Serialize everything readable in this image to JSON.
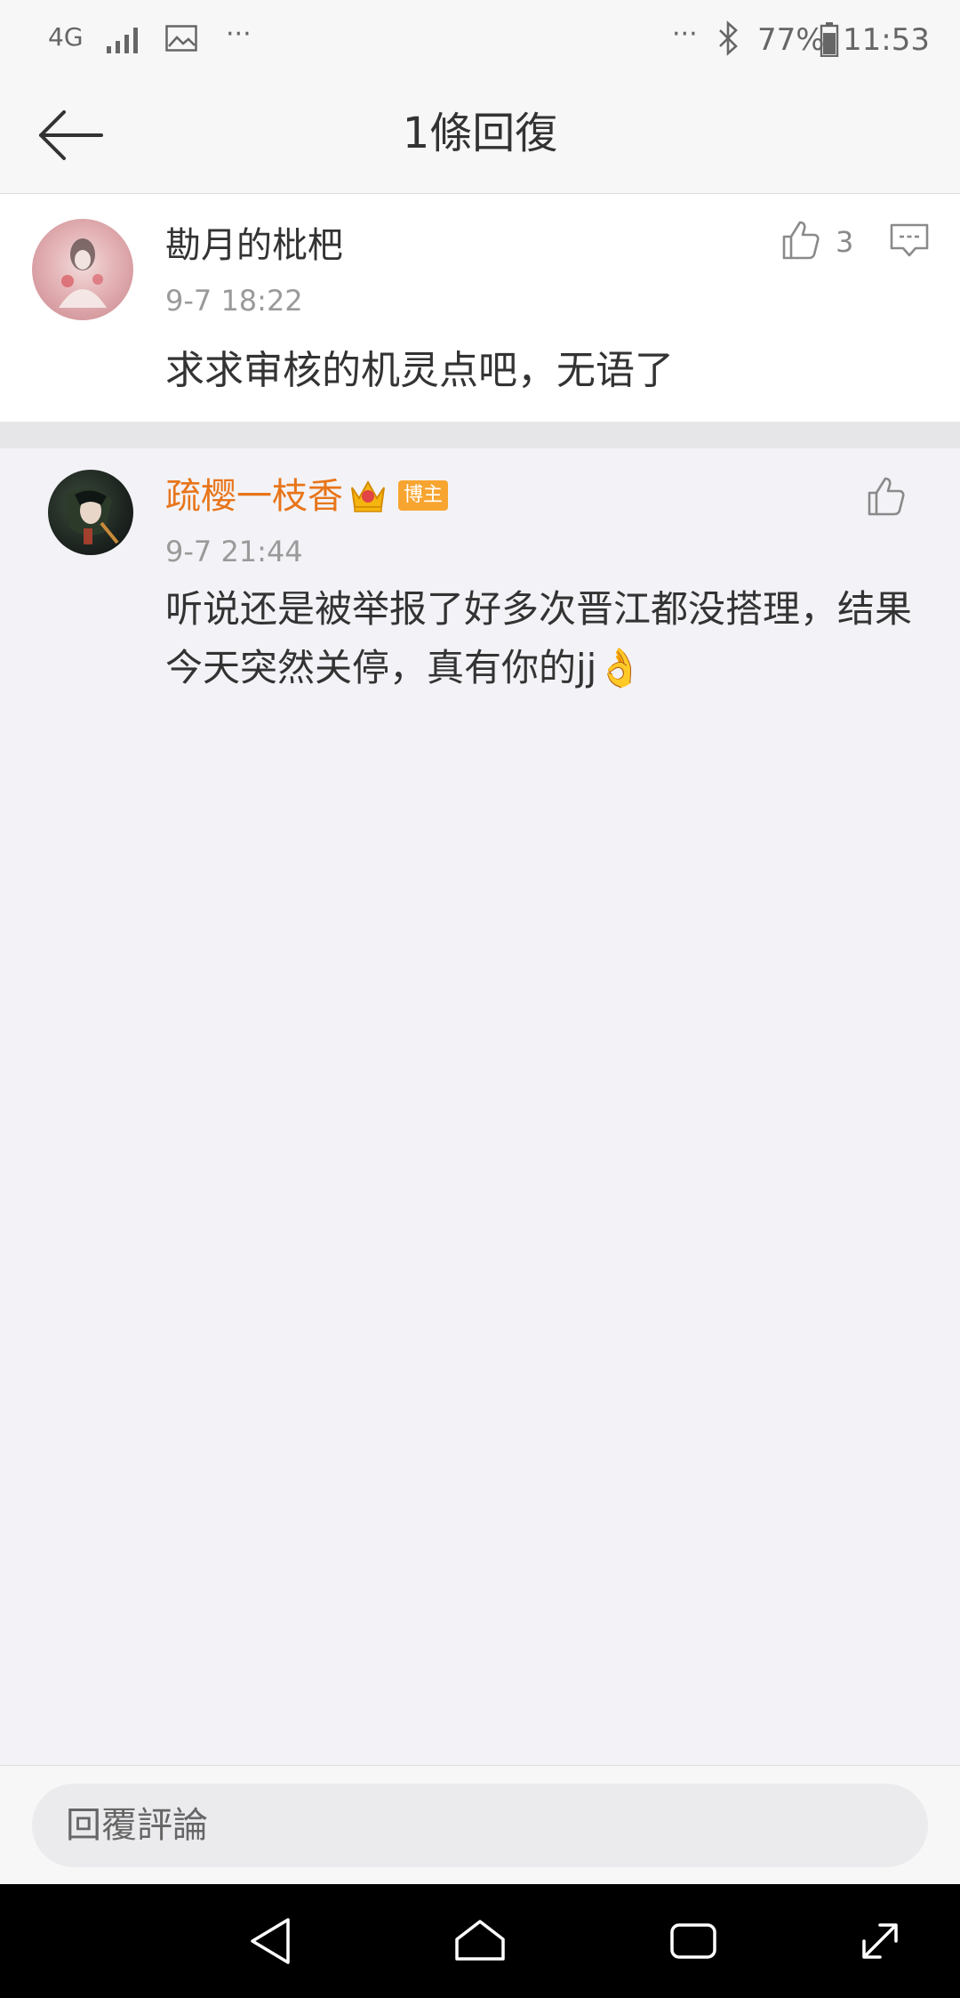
{
  "status_bar": {
    "network": "4G",
    "more_dots": "···",
    "battery": "77%",
    "time": "11:53"
  },
  "header": {
    "title": "1條回復"
  },
  "main_comment": {
    "author": "勘月的枇杷",
    "time": "9-7 18:22",
    "text": "求求审核的机灵点吧，无语了",
    "like_count": "3"
  },
  "reply": {
    "author": "疏樱一枝香",
    "badge": "博主",
    "time": "9-7 21:44",
    "text": "听说还是被举报了好多次晋江都没搭理，结果今天突然关停，真有你的jj👌"
  },
  "reply_bar": {
    "placeholder": "回覆評論"
  },
  "colors": {
    "accent_orange": "#e8751a",
    "badge_orange": "#f7a530",
    "background": "#f3f3f7"
  },
  "icons": [
    "back-arrow-icon",
    "thumbs-up-icon",
    "comment-icon",
    "crown-icon",
    "nav-back-icon",
    "nav-home-icon",
    "nav-recents-icon",
    "nav-expand-icon"
  ]
}
